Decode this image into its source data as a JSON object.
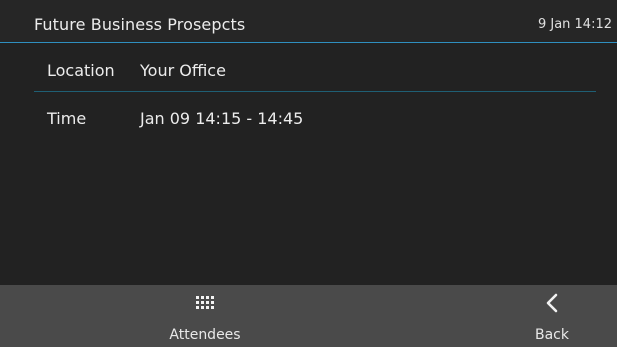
{
  "header": {
    "title": "Future Business Prosepcts",
    "clock": "9 Jan 14:12",
    "accent_color": "#2f8fbf"
  },
  "details": [
    {
      "label": "Location",
      "value": "Your Office"
    },
    {
      "label": "Time",
      "value": "Jan 09 14:15 - 14:45"
    }
  ],
  "softkeys": {
    "attendees": {
      "label": "Attendees",
      "icon": "keypad-grid-icon"
    },
    "back": {
      "label": "Back",
      "icon": "chevron-left-icon"
    }
  }
}
